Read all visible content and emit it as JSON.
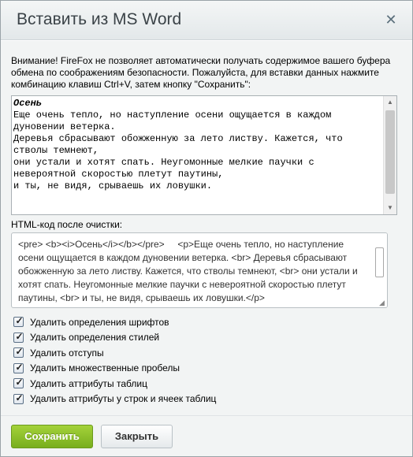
{
  "dialog": {
    "title": "Вставить из MS Word",
    "close_glyph": "✕",
    "warning": "Внимание! FireFox не позволяет автоматически получать содержимое вашего буфера обмена по соображениям безопасности. Пожалуйста, для вставки данных нажмите комбинацию клавиш Ctrl+V, затем кнопку \"Сохранить\":",
    "editor": {
      "heading": "Осень",
      "text": "\nЕще очень тепло, но наступление осени ощущается в каждом дуновении ветерка.\nДеревья сбрасывают обожженную за лето листву. Кажется, что стволы темнеют,\nони устали и хотят спать. Неугомонные мелкие паучки с невероятной скоростью плетут паутины,\nи ты, не видя, срываешь их ловушки."
    },
    "html_label": "HTML-код после очистки:",
    "html_code": "<pre> <b><i>Осень</i></b></pre>     <p>Еще очень тепло, но наступление осени ощущается в каждом дуновении ветерка. <br> Деревья сбрасывают обожженную за лето листву. Кажется, что стволы темнеют, <br> они устали и хотят спать. Неугомонные мелкие паучки с невероятной скоростью плетут паутины, <br> и ты, не видя, срываешь их ловушки.</p>",
    "options": [
      {
        "label": "Удалить определения шрифтов",
        "checked": true
      },
      {
        "label": "Удалить определения стилей",
        "checked": true
      },
      {
        "label": "Удалить отступы",
        "checked": true
      },
      {
        "label": "Удалить множественные пробелы",
        "checked": true
      },
      {
        "label": "Удалить аттрибуты таблиц",
        "checked": true
      },
      {
        "label": "Удалить аттрибуты у строк и ячеек таблиц",
        "checked": true
      }
    ],
    "buttons": {
      "save": "Сохранить",
      "close": "Закрыть"
    },
    "colors": {
      "save_button": "#8cc12b",
      "titlebar": "#e8ecee",
      "body": "#f2f4f4"
    }
  }
}
